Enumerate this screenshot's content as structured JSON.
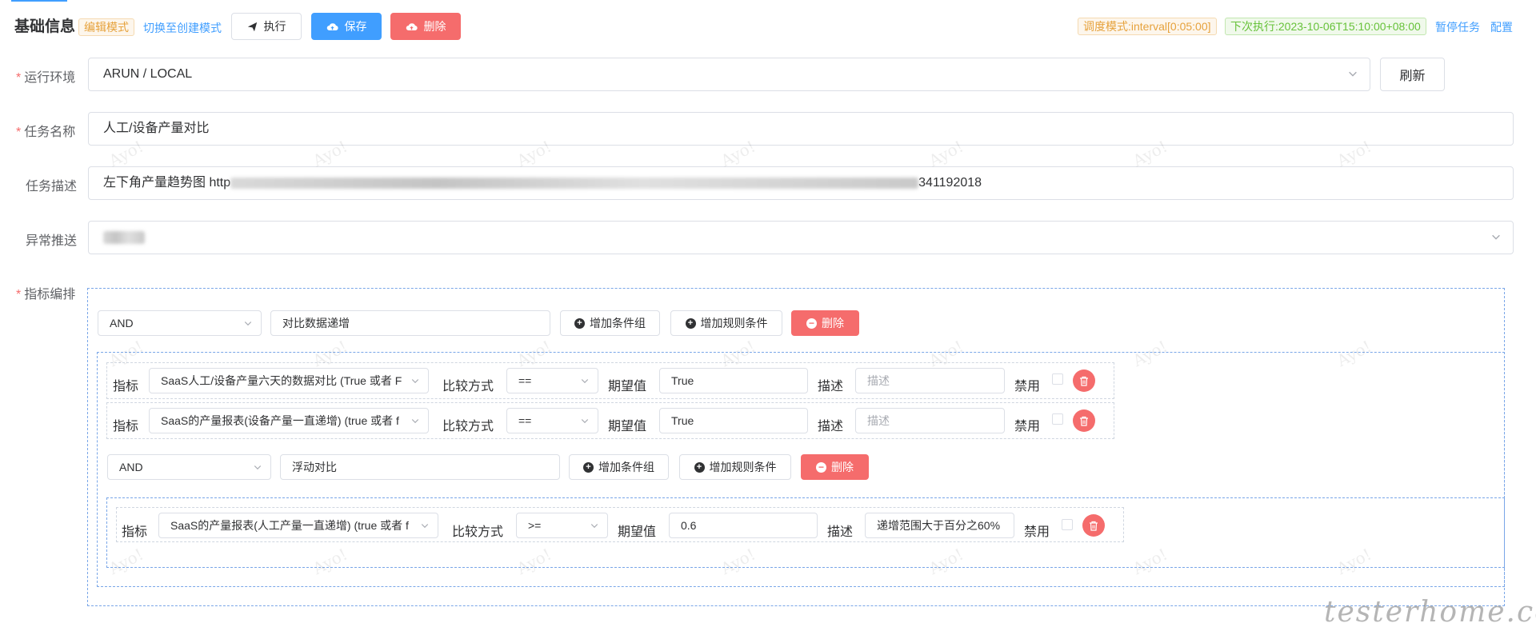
{
  "header": {
    "title": "基础信息",
    "mode_badge": "编辑模式",
    "switch_link": "切换至创建模式",
    "exec_label": "执行",
    "save_label": "保存",
    "delete_label": "删除",
    "schedule_tag": "调度模式:interval[0:05:00]",
    "next_exec_tag": "下次执行:2023-10-06T15:10:00+08:00",
    "pause_link": "暂停任务",
    "config_link": "配置"
  },
  "form": {
    "env": {
      "label": "运行环境",
      "value": "ARUN / LOCAL",
      "refresh": "刷新"
    },
    "name": {
      "label": "任务名称",
      "value": "人工/设备产量对比"
    },
    "desc": {
      "label": "任务描述",
      "value_prefix": "左下角产量趋势图 http",
      "value_suffix": "341192018"
    },
    "alert": {
      "label": "异常推送"
    },
    "rules_label": "指标编排"
  },
  "rules": {
    "group1": {
      "logic": "AND",
      "name": "对比数据递增",
      "add_group": "增加条件组",
      "add_rule": "增加规则条件",
      "delete": "删除",
      "conditions": [
        {
          "metric_label": "指标",
          "metric": "SaaS人工/设备产量六天的数据对比 (True 或者 F",
          "cmp_label": "比较方式",
          "cmp": "==",
          "expect_label": "期望值",
          "expect": "True",
          "desc_label": "描述",
          "desc_placeholder": "描述",
          "disable_label": "禁用"
        },
        {
          "metric_label": "指标",
          "metric": "SaaS的产量报表(设备产量一直递增) (true 或者 f",
          "cmp_label": "比较方式",
          "cmp": "==",
          "expect_label": "期望值",
          "expect": "True",
          "desc_label": "描述",
          "desc_placeholder": "描述",
          "disable_label": "禁用"
        }
      ]
    },
    "group2": {
      "logic": "AND",
      "name": "浮动对比",
      "add_group": "增加条件组",
      "add_rule": "增加规则条件",
      "delete": "删除",
      "conditions": [
        {
          "metric_label": "指标",
          "metric": "SaaS的产量报表(人工产量一直递增) (true 或者 f",
          "cmp_label": "比较方式",
          "cmp": ">=",
          "expect_label": "期望值",
          "expect": "0.6",
          "desc_label": "描述",
          "desc_value": "递增范围大于百分之60%",
          "disable_label": "禁用"
        }
      ]
    }
  },
  "watermark_text": "Ayo!",
  "site_watermark": "testerhome.com",
  "colors": {
    "primary": "#409eff",
    "danger": "#f56c6c",
    "warning": "#e6a23c",
    "success": "#67c23a"
  }
}
